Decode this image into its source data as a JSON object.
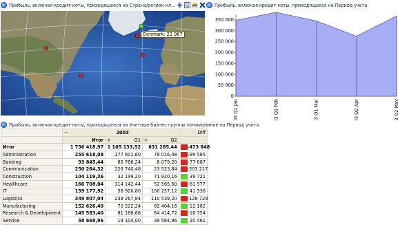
{
  "map_panel": {
    "title": "Прибыль, включая кредит-ноты, приходящееся на Страна/регион кл...",
    "tooltip": "Denmark: 22 967",
    "icons": [
      "globe-icon",
      "expand-icon",
      "list-icon",
      "print-icon",
      "close-icon"
    ]
  },
  "chart_panel": {
    "title": "Прибыль, включая кредит-ноты, приходящееся на Период учета"
  },
  "chart_data": {
    "type": "area",
    "categories": [
      "2003 Q1 Jan",
      "2003 Q1 Feb",
      "2003 Q1 Mar",
      "2003 Q2 Apr",
      "2003 Q2 May"
    ],
    "values": [
      348000,
      385000,
      345000,
      275000,
      368000
    ],
    "ylim": [
      0,
      350000
    ],
    "yticks": [
      "0",
      "50 000",
      "100 000",
      "150 000",
      "200 000",
      "250 000",
      "300 000",
      "350 000"
    ],
    "colors": {
      "fill": "#a7aef3",
      "stroke": "#4a4f9a"
    }
  },
  "grid_panel": {
    "title": "Прибыль, включая кредит-ноты, приходящееся на Учетные бизнес-группы пониманиное на Период учета",
    "year": "2003",
    "diff_label": "Diff",
    "col_total": "Итог",
    "col_q1": "Q1",
    "col_q2": "Q2",
    "collapse": "−",
    "expand": "+",
    "rows": [
      {
        "name": "Итог",
        "total": "1 736 418,97",
        "q1": "1 105 133,52",
        "q2": "631 285,44",
        "diff": "-473 848",
        "status": "red",
        "bold": true
      },
      {
        "name": "Administration",
        "total": "255 618,08",
        "q1": "177 601,60",
        "q2": "78 016,48",
        "diff": "-99 585",
        "status": "red"
      },
      {
        "name": "Banking",
        "total": "93 845,44",
        "q1": "85 766,24",
        "q2": "8 079,20",
        "diff": "-77 687",
        "status": "red"
      },
      {
        "name": "Communication",
        "total": "250 264,32",
        "q1": "226 740,48",
        "q2": "23 523,84",
        "diff": "-203 217",
        "status": "red"
      },
      {
        "name": "Construction",
        "total": "104 119,36",
        "q1": "32 199,20",
        "q2": "71 920,16",
        "diff": "39 721",
        "status": "green"
      },
      {
        "name": "Healthcare",
        "total": "166 708,04",
        "q1": "114 142,44",
        "q2": "52 565,60",
        "diff": "-61 577",
        "status": "red"
      },
      {
        "name": "IT",
        "total": "159 177,92",
        "q1": "58 920,80",
        "q2": "100 257,12",
        "diff": "41 336",
        "status": "green"
      },
      {
        "name": "Logistics",
        "total": "349 807,04",
        "q1": "239 267,84",
        "q2": "110 539,20",
        "diff": "-128 729",
        "status": "red"
      },
      {
        "name": "Manufacturing",
        "total": "152 626,40",
        "q1": "70 222,24",
        "q2": "82 404,16",
        "diff": "12 182",
        "status": "green"
      },
      {
        "name": "Research & Development",
        "total": "145 583,40",
        "q1": "81 168,68",
        "q2": "64 414,72",
        "diff": "-16 754",
        "status": "red"
      },
      {
        "name": "Service",
        "total": "58 668,96",
        "q1": "19 104,00",
        "q2": "39 564,96",
        "diff": "20 461",
        "status": "green"
      }
    ]
  }
}
